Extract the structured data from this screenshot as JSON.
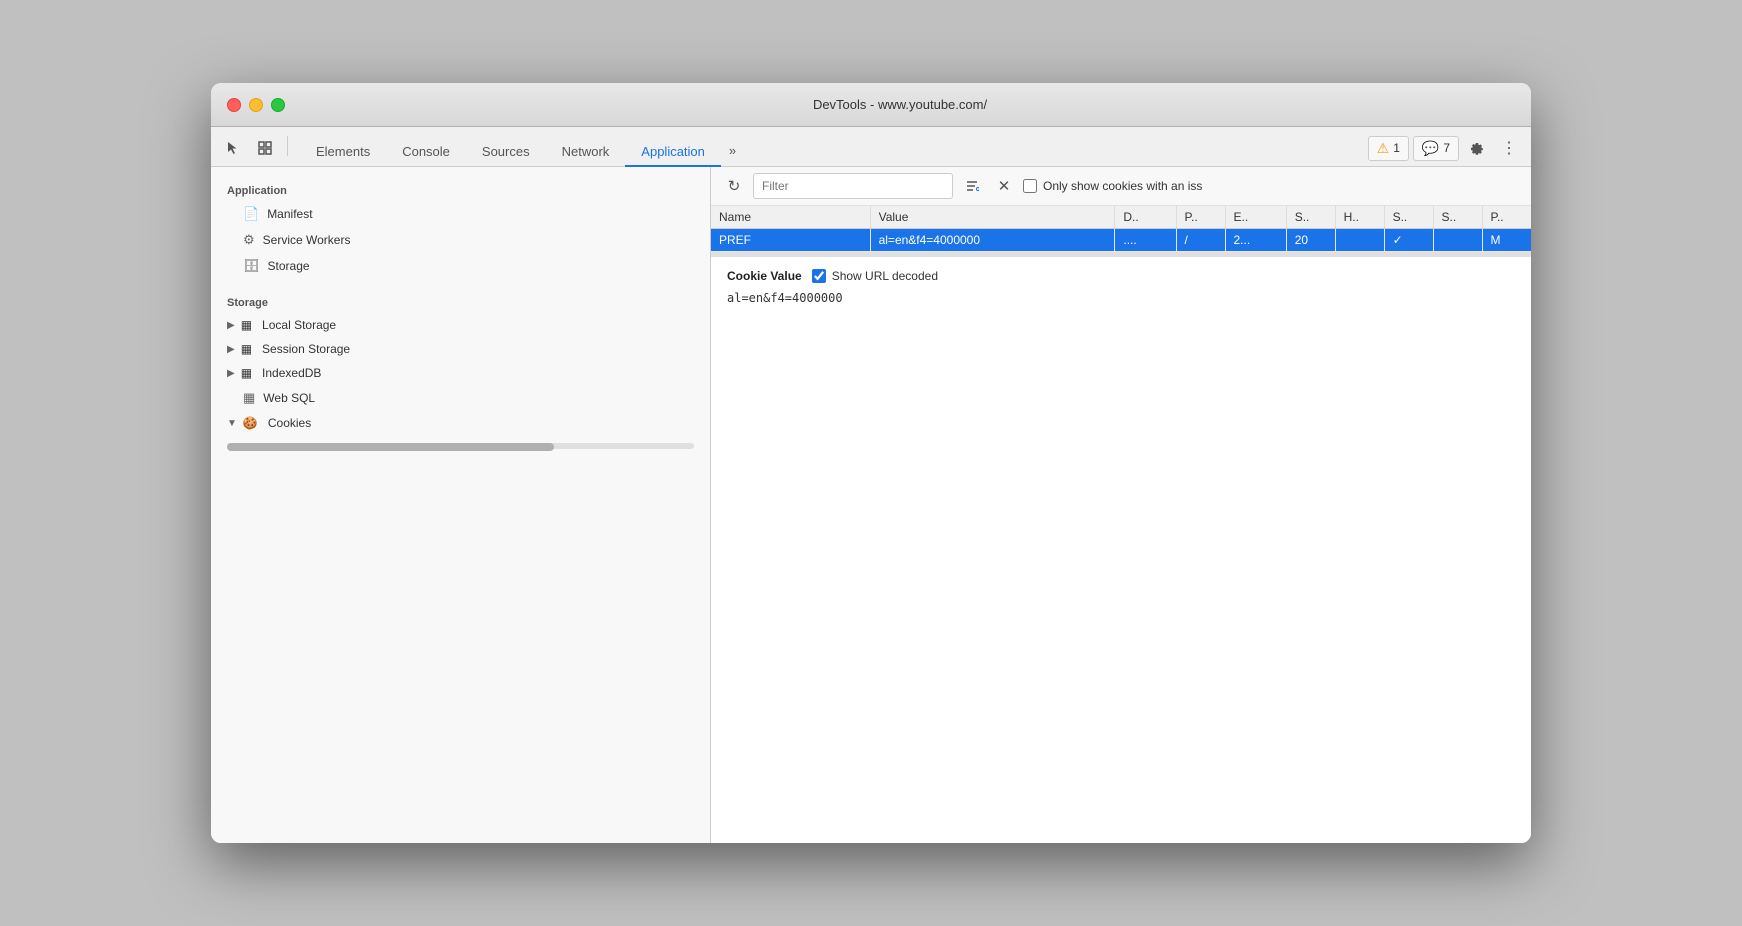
{
  "window": {
    "title": "DevTools - www.youtube.com/"
  },
  "tabs": [
    {
      "label": "Elements",
      "active": false
    },
    {
      "label": "Console",
      "active": false
    },
    {
      "label": "Sources",
      "active": false
    },
    {
      "label": "Network",
      "active": false
    },
    {
      "label": "Application",
      "active": true
    }
  ],
  "tab_more": "»",
  "badges": {
    "warning_count": "1",
    "message_count": "7"
  },
  "toolbar": {
    "filter_placeholder": "Filter",
    "only_show_label": "Only show cookies with an iss"
  },
  "sidebar": {
    "app_section": "Application",
    "app_items": [
      {
        "icon": "📄",
        "label": "Manifest"
      },
      {
        "icon": "⚙️",
        "label": "Service Workers"
      },
      {
        "icon": "🗄",
        "label": "Storage"
      }
    ],
    "storage_section": "Storage",
    "storage_items": [
      {
        "icon": "▦",
        "label": "Local Storage",
        "expandable": true
      },
      {
        "icon": "▦",
        "label": "Session Storage",
        "expandable": true
      },
      {
        "icon": "▦",
        "label": "IndexedDB",
        "expandable": true
      },
      {
        "icon": "▦",
        "label": "Web SQL",
        "expandable": false
      },
      {
        "icon": "🍪",
        "label": "Cookies",
        "expandable": true,
        "expanded": true
      }
    ]
  },
  "cookies_table": {
    "headers": [
      "Name",
      "Value",
      "D..",
      "P..",
      "E..",
      "S..",
      "H..",
      "S..",
      "S..",
      "P.."
    ],
    "rows": [
      {
        "name": "PREF",
        "value": "al=en&f4=4000000",
        "d": "....",
        "p": "/",
        "e": "2...",
        "s": "20",
        "h": "",
        "s2": "✓",
        "s3": "",
        "p2": "M",
        "selected": true
      }
    ]
  },
  "cookie_detail": {
    "title": "Cookie Value",
    "show_url_decoded": true,
    "url_decode_label": "Show URL decoded",
    "value": "al=en&f4=4000000"
  }
}
